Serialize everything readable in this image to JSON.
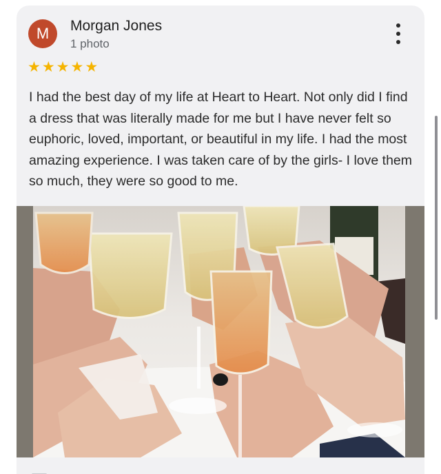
{
  "review": {
    "avatar_letter": "M",
    "reviewer_name": "Morgan Jones",
    "photo_count_label": "1 photo",
    "rating": 5,
    "stars": [
      "★",
      "★",
      "★",
      "★",
      "★"
    ],
    "text": "I had the best day of my life at Heart to Heart. Not only did I find a dress that was literally made for me but I have never felt so euphoric, loved, important, or beautiful in my life. I had the most amazing experience. I was taken care of by the girls- I love them so much, they were so good to me.",
    "photo_description": "Hands clinking champagne glasses"
  },
  "colors": {
    "avatar_bg": "#c0492b",
    "star": "#f5b400",
    "card_bg": "#f1f1f3"
  },
  "icons": {
    "more": "more-vert-icon",
    "star": "star-icon"
  }
}
